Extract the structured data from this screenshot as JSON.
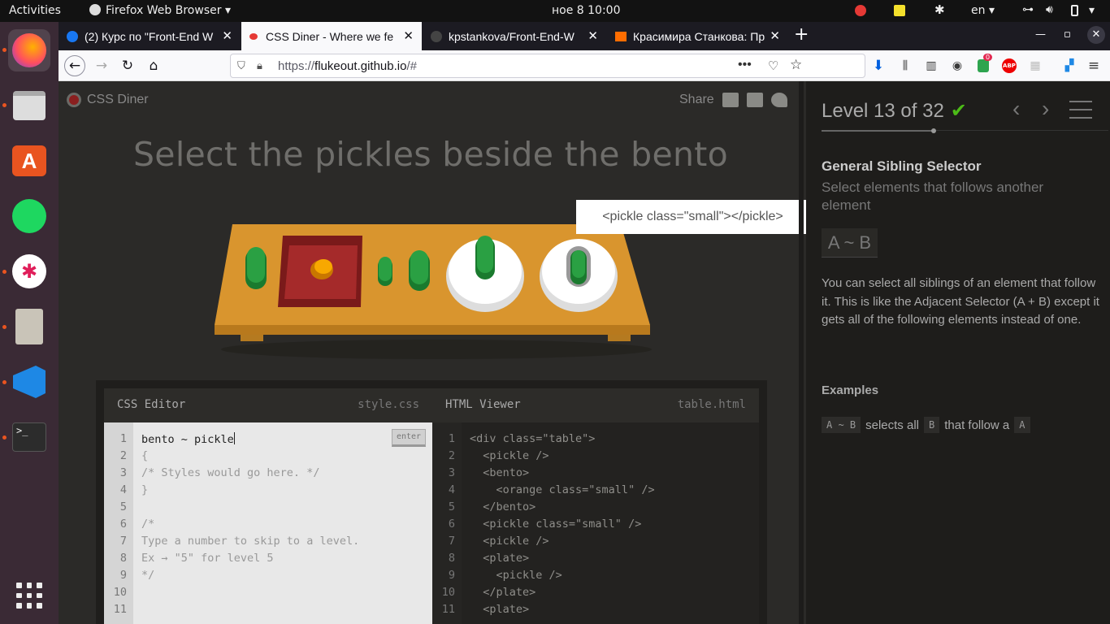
{
  "topbar": {
    "activities": "Activities",
    "app_menu": "Firefox Web Browser",
    "clock": "ное 8  10:00",
    "keyboard_layout": "en"
  },
  "tabs": [
    {
      "title": "(2) Курс по \"Front-End W",
      "favicon": "facebook-icon"
    },
    {
      "title": "CSS Diner - Where we fe",
      "favicon": "css-diner-icon"
    },
    {
      "title": "kpstankova/Front-End-W",
      "favicon": "github-icon"
    },
    {
      "title": "Красимира Станкова: Пр",
      "favicon": "linkedin-icon"
    }
  ],
  "urlbar": {
    "prefix": "https://",
    "host": "flukeout.github.io",
    "path": "/#"
  },
  "toolbar": {
    "badge_count": "0",
    "abp_label": "ABP"
  },
  "page": {
    "logo": "CSS Diner",
    "share": "Share",
    "instruction": "Select the pickles beside the bento",
    "tooltip": "<pickle class=\"small\"></pickle>"
  },
  "editor": {
    "css_title": "CSS Editor",
    "css_file": "style.css",
    "html_title": "HTML Viewer",
    "html_file": "table.html",
    "enter_label": "enter",
    "input_value": "bento ~ pickle",
    "css_lines": [
      "{",
      "/* Styles would go here. */",
      "}",
      "",
      "/*",
      "Type a number to skip to a level.",
      "Ex → \"5\" for level 5",
      "*/",
      ""
    ],
    "html_lines": [
      "<div class=\"table\">",
      "  <pickle />",
      "  <bento>",
      "    <orange class=\"small\" />",
      "  </bento>",
      "  <pickle class=\"small\" />",
      "  <pickle />",
      "  <plate>",
      "    <pickle />",
      "  </plate>",
      "  <plate>"
    ],
    "line_numbers": [
      "1",
      "2",
      "3",
      "4",
      "5",
      "6",
      "7",
      "8",
      "9",
      "10",
      "11"
    ]
  },
  "sidebar": {
    "level": "Level 13 of 32",
    "selector_name": "General Sibling Selector",
    "selector_title": "Select elements that follows another element",
    "syntax": "A ~ B",
    "hint": "You can select all siblings of an element that follow it. This is like the Adjacent Selector (A + B) except it gets all of the following elements instead of one.",
    "examples_title": "Examples",
    "example": {
      "code": "A ~ B",
      "text1": "selects all",
      "b": "B",
      "text2": "that follow a",
      "a": "A"
    }
  },
  "colors": {
    "accent_orange": "#e95420",
    "check_green": "#4cbb17",
    "table_wood": "#d9952e"
  }
}
